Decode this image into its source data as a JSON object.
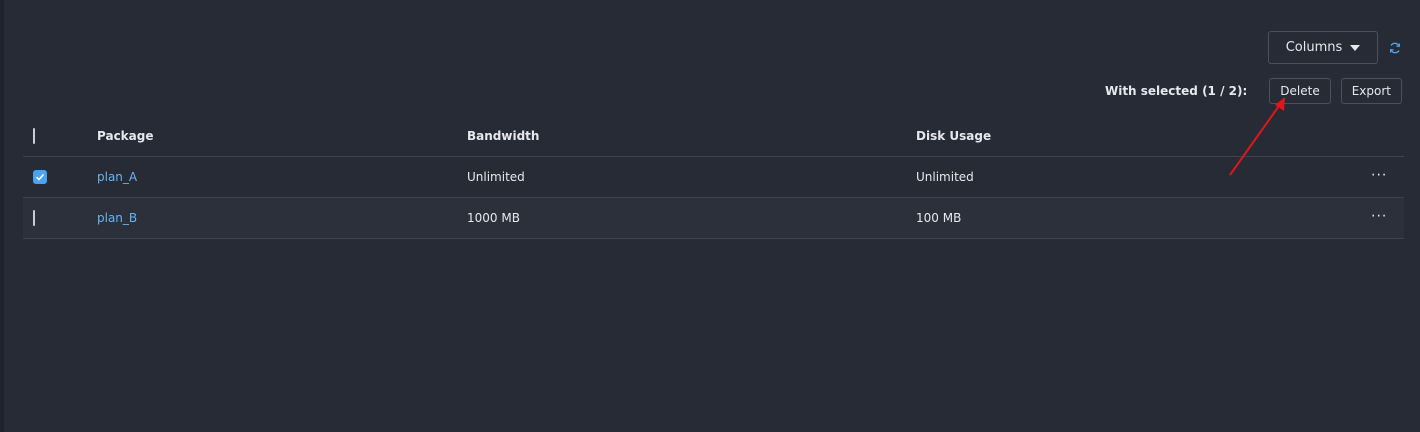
{
  "toolbar": {
    "columns_label": "Columns",
    "refresh_icon": "refresh-icon"
  },
  "bulk": {
    "label": "With selected (1 / 2):",
    "delete_label": "Delete",
    "export_label": "Export"
  },
  "table": {
    "headers": [
      "Package",
      "Bandwidth",
      "Disk Usage"
    ],
    "rows": [
      {
        "package": "plan_A",
        "bandwidth": "Unlimited",
        "disk": "Unlimited",
        "selected": true
      },
      {
        "package": "plan_B",
        "bandwidth": "1000 MB",
        "disk": "100 MB",
        "selected": false
      }
    ],
    "more_label": "···"
  },
  "colors": {
    "background": "#272b35",
    "link": "#68b4f5",
    "checkbox_checked": "#4aa3f0",
    "annotation_arrow": "#e0161e"
  }
}
